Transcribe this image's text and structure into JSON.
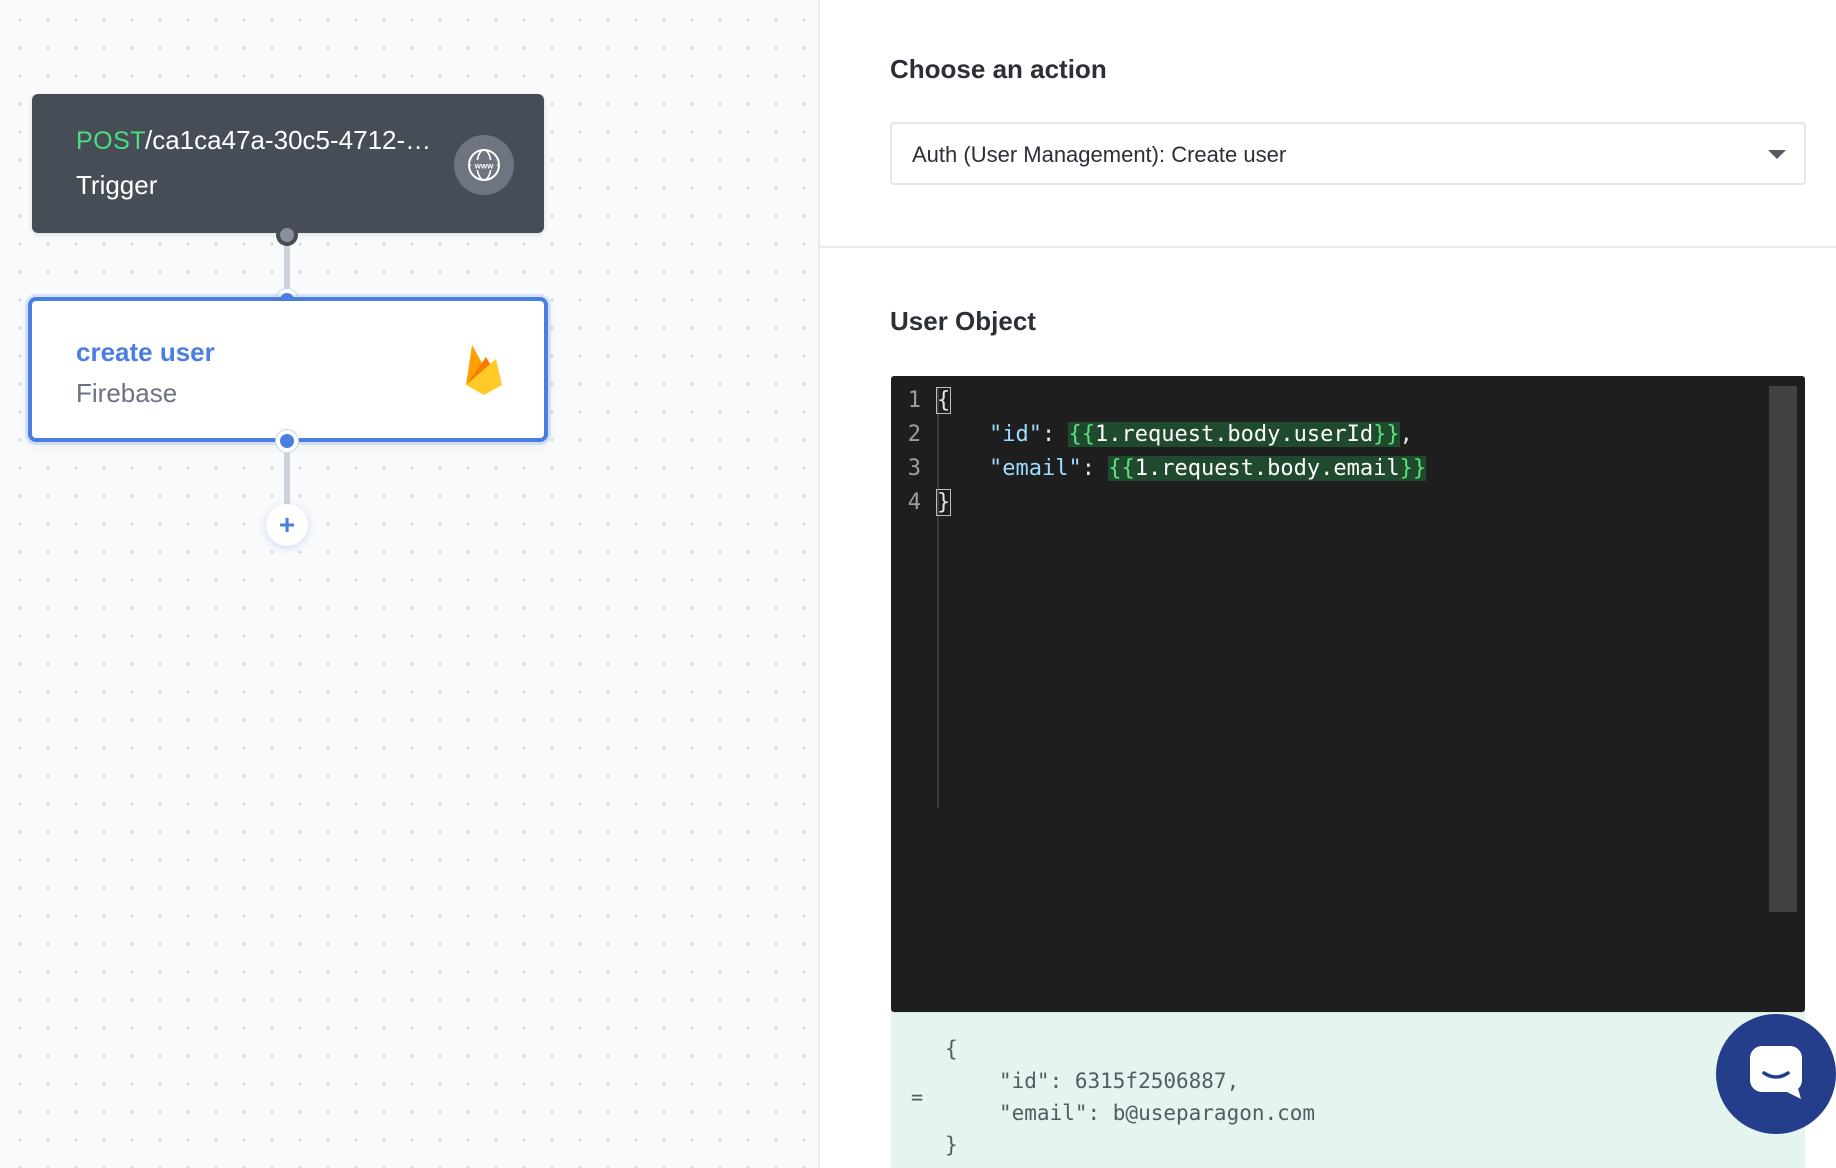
{
  "workflow": {
    "trigger": {
      "method": "POST",
      "path": "/ca1ca47a-30c5-4712-…",
      "label": "Trigger",
      "icon": "www-globe-icon"
    },
    "step": {
      "title": "create user",
      "integration": "Firebase",
      "icon": "firebase-icon"
    },
    "add_step_label": "+"
  },
  "action_panel": {
    "title": "Choose an action",
    "selected_action": "Auth (User Management): Create user"
  },
  "user_object": {
    "title": "User Object",
    "line_numbers": [
      "1",
      "2",
      "3",
      "4"
    ],
    "code": {
      "open": "{",
      "id_key": "\"id\"",
      "id_tpl_open": "{{",
      "id_tpl_body": "1.request.body.userId",
      "id_tpl_close": "}}",
      "email_key": "\"email\"",
      "email_tpl_open": "{{",
      "email_tpl_body": "1.request.body.email",
      "email_tpl_close": "}}",
      "close": "}"
    },
    "preview": {
      "eq": "=",
      "open": "{",
      "id_line": "\"id\": 6315f2506887,",
      "email_line": "\"email\": b@useparagon.com",
      "close": "}"
    }
  },
  "colors": {
    "accent": "#4a7fe0",
    "trigger_bg": "#474d57",
    "method_green": "#4ade80",
    "editor_bg": "#1e1e1e",
    "preview_bg": "#e4f4ee",
    "chat_bg": "#243e8c"
  }
}
